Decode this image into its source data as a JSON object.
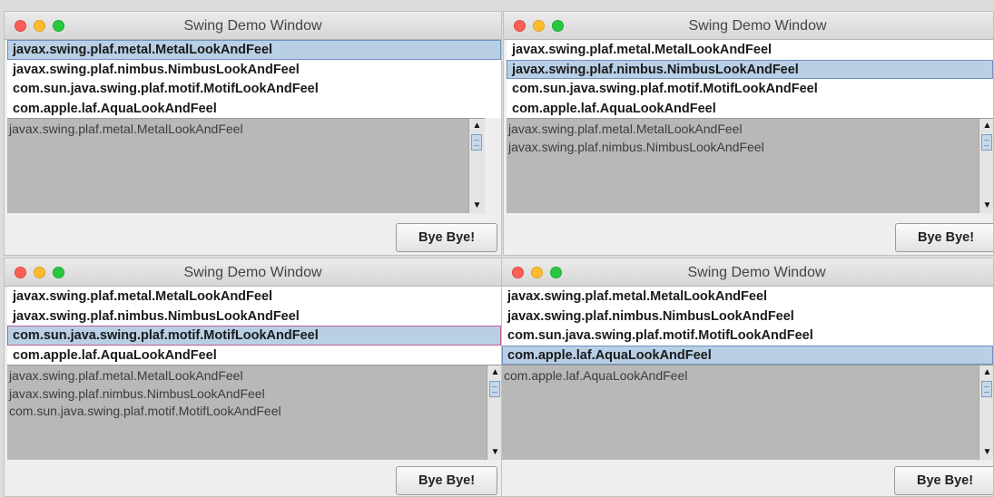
{
  "windows": [
    {
      "title": "Swing Demo Window",
      "list_items": [
        "javax.swing.plaf.metal.MetalLookAndFeel",
        "javax.swing.plaf.nimbus.NimbusLookAndFeel",
        "com.sun.java.swing.plaf.motif.MotifLookAndFeel",
        "com.apple.laf.AquaLookAndFeel"
      ],
      "selected_index": 0,
      "text_area_lines": [
        "javax.swing.plaf.metal.MetalLookAndFeel"
      ],
      "button_label": "Bye Bye!"
    },
    {
      "title": "Swing Demo Window",
      "list_items": [
        "javax.swing.plaf.metal.MetalLookAndFeel",
        "javax.swing.plaf.nimbus.NimbusLookAndFeel",
        "com.sun.java.swing.plaf.motif.MotifLookAndFeel",
        "com.apple.laf.AquaLookAndFeel"
      ],
      "selected_index": 1,
      "text_area_lines": [
        "javax.swing.plaf.metal.MetalLookAndFeel",
        "javax.swing.plaf.nimbus.NimbusLookAndFeel"
      ],
      "button_label": "Bye Bye!"
    },
    {
      "title": "Swing Demo Window",
      "list_items": [
        "javax.swing.plaf.metal.MetalLookAndFeel",
        "javax.swing.plaf.nimbus.NimbusLookAndFeel",
        "com.sun.java.swing.plaf.motif.MotifLookAndFeel",
        "com.apple.laf.AquaLookAndFeel"
      ],
      "selected_index": 2,
      "text_area_lines": [
        "javax.swing.plaf.metal.MetalLookAndFeel",
        "javax.swing.plaf.nimbus.NimbusLookAndFeel",
        "com.sun.java.swing.plaf.motif.MotifLookAndFeel"
      ],
      "button_label": "Bye Bye!"
    },
    {
      "title": "Swing Demo Window",
      "list_items": [
        "javax.swing.plaf.metal.MetalLookAndFeel",
        "javax.swing.plaf.nimbus.NimbusLookAndFeel",
        "com.sun.java.swing.plaf.motif.MotifLookAndFeel",
        "com.apple.laf.AquaLookAndFeel"
      ],
      "selected_index": 3,
      "text_area_lines": [
        "com.apple.laf.AquaLookAndFeel"
      ],
      "button_label": "Bye Bye!"
    }
  ],
  "colors": {
    "selection_bg": "#b8cfe5",
    "selection_border": "#6e93bd",
    "text_area_bg": "#b8b8b8",
    "close_light": "#fc5f57",
    "minimize_light": "#fdbc2e",
    "zoom_light": "#28c840"
  },
  "icons": {
    "close": "close-light-icon",
    "minimize": "minimize-light-icon",
    "zoom": "zoom-light-icon",
    "scroll_up": "arrow-up-icon",
    "scroll_down": "arrow-down-icon"
  }
}
